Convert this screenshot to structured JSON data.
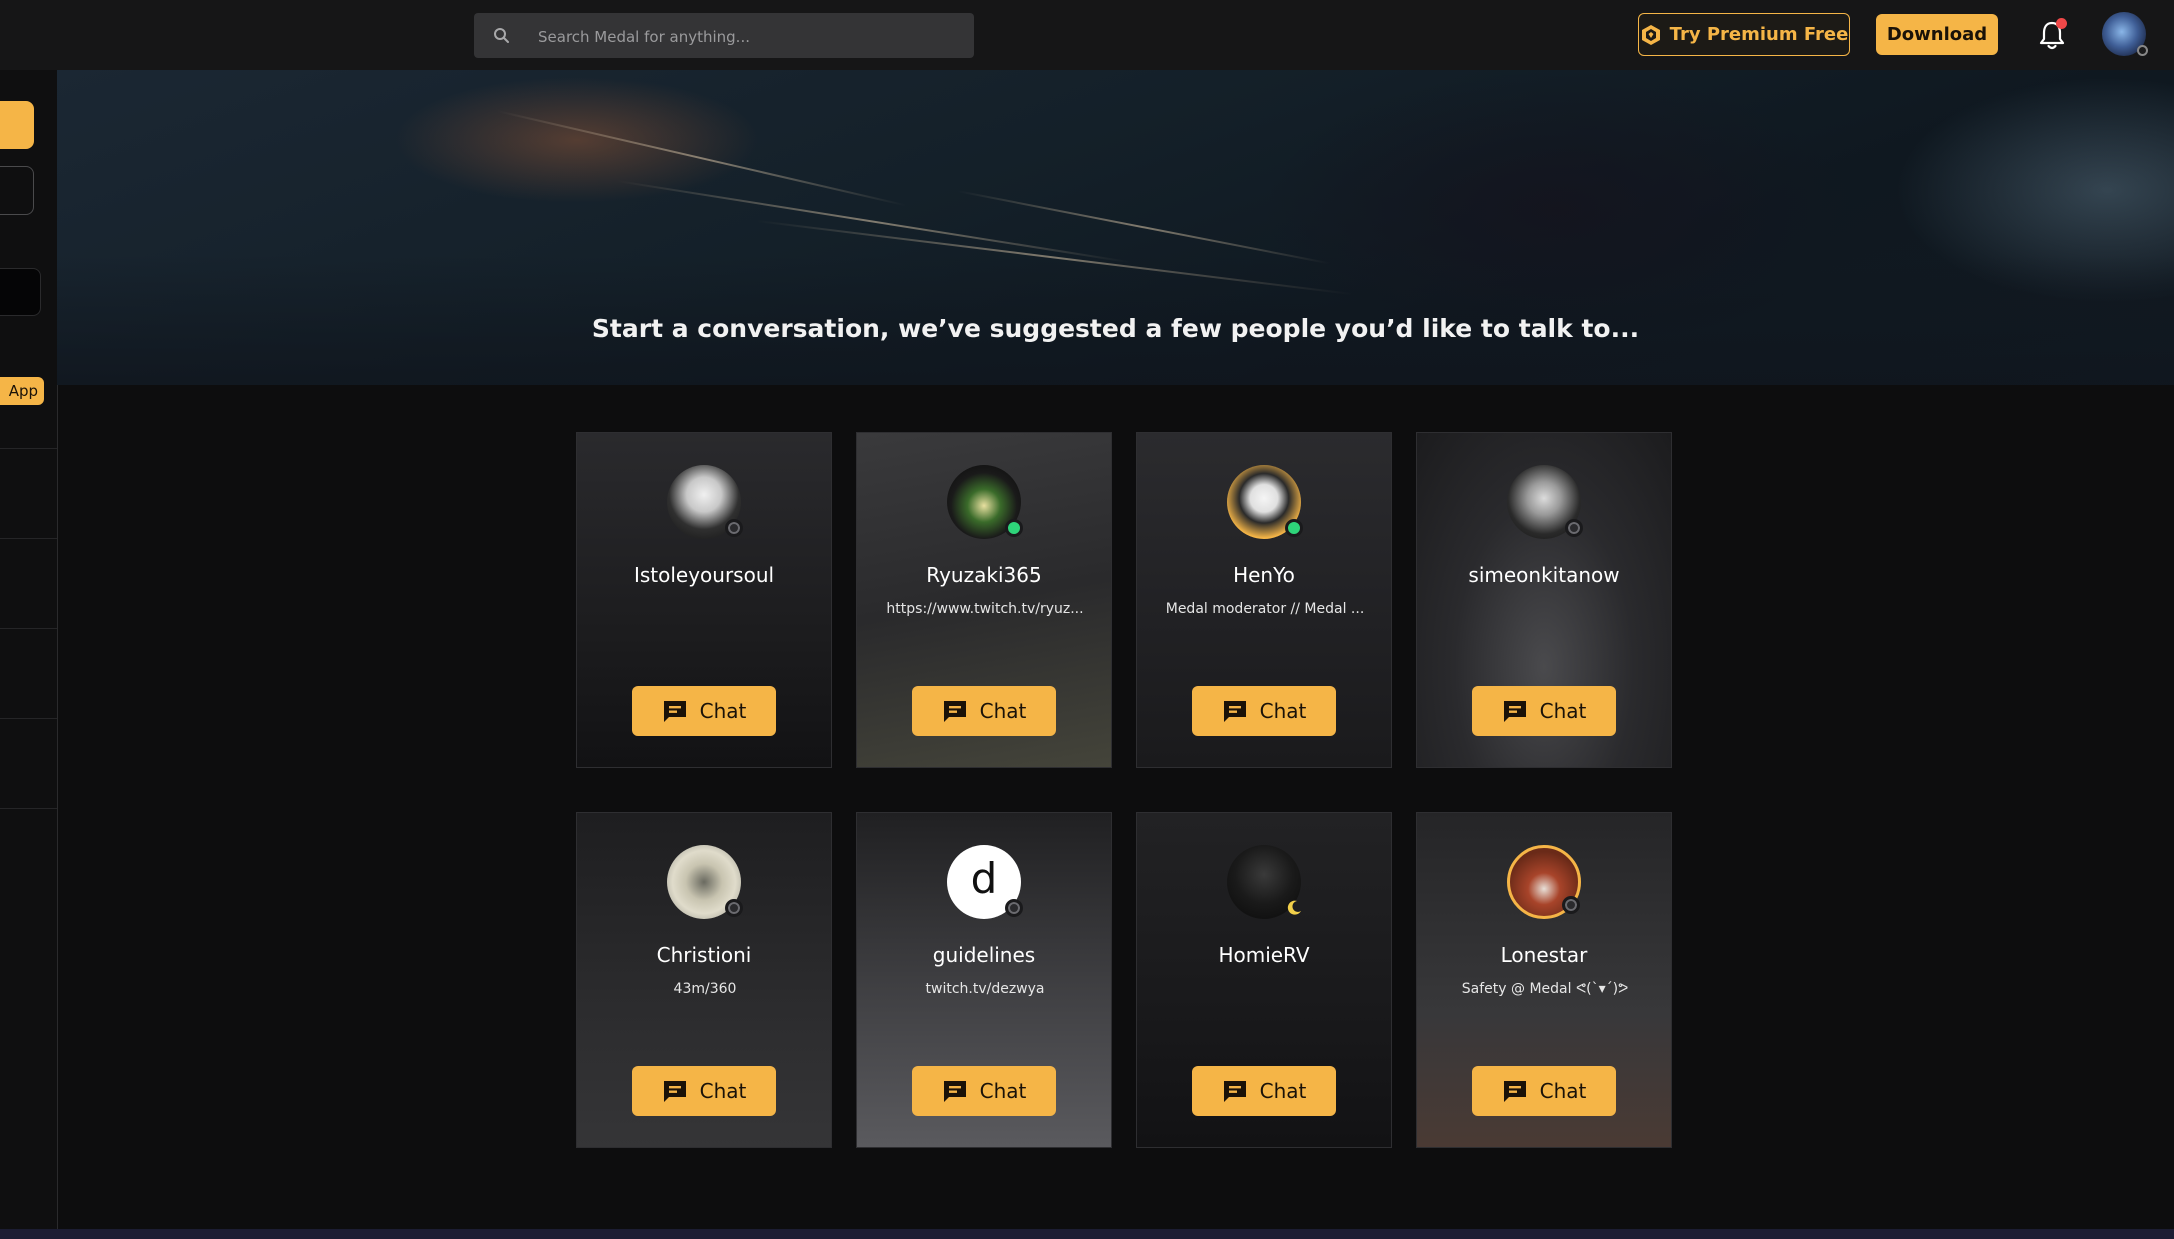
{
  "search": {
    "placeholder": "Search Medal for anything..."
  },
  "header": {
    "premium_label": "Try Premium Free",
    "download_label": "Download"
  },
  "sidebar": {
    "app_label": "App"
  },
  "hero": {
    "text": "Start a conversation, we’ve suggested a few people you’d like to talk to..."
  },
  "colors": {
    "accent": "#f5b547",
    "online": "#2ed47a",
    "background": "#0d0d0e"
  },
  "cards": [
    {
      "name": "Istoleyoursoul",
      "bio": "",
      "status": "offline",
      "chat_label": "Chat"
    },
    {
      "name": "Ryuzaki365",
      "bio": "https://www.twitch.tv/ryuz...",
      "status": "online",
      "chat_label": "Chat"
    },
    {
      "name": "HenYo",
      "bio": "Medal moderator // Medal ...",
      "status": "online",
      "chat_label": "Chat"
    },
    {
      "name": "simeonkitanow",
      "bio": "",
      "status": "offline",
      "chat_label": "Chat"
    },
    {
      "name": "Christioni",
      "bio": "43m/360",
      "status": "offline",
      "chat_label": "Chat"
    },
    {
      "name": "guidelines",
      "bio": "twitch.tv/dezwya",
      "status": "offline",
      "chat_label": "Chat",
      "avatar_letter": "d"
    },
    {
      "name": "HomieRV",
      "bio": "",
      "status": "away",
      "chat_label": "Chat"
    },
    {
      "name": "Lonestar",
      "bio": "Safety @ Medal ᕙ(`▾´)ᕗ",
      "status": "offline",
      "chat_label": "Chat"
    }
  ]
}
